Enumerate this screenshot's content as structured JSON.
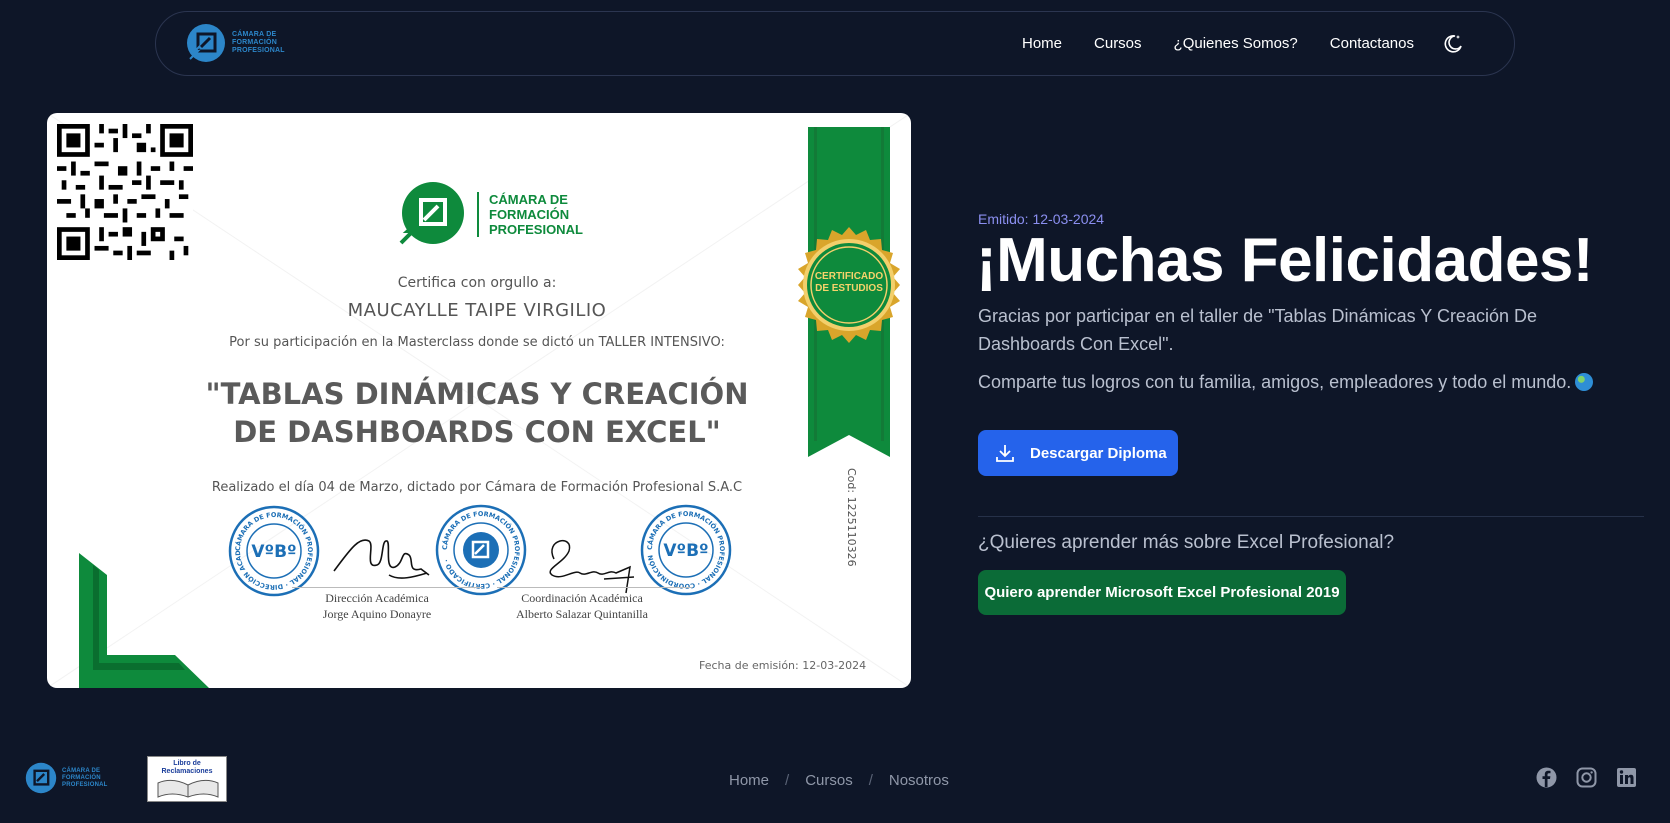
{
  "nav": {
    "logo_text": [
      "CÁMARA DE",
      "FORMACIÓN",
      "PROFESIONAL"
    ],
    "links": [
      "Home",
      "Cursos",
      "¿Quienes Somos?",
      "Contactanos"
    ],
    "theme_icon": "moon-stars-icon"
  },
  "certificate": {
    "logo_text": [
      "CÁMARA DE",
      "FORMACIÓN",
      "PROFESIONAL"
    ],
    "certifica": "Certifica con orgullo a:",
    "recipient": "MAUCAYLLE TAIPE VIRGILIO",
    "participation": "Por su participación en la Masterclass donde se dictó un TALLER INTENSIVO:",
    "course_title_line1": "\"TABLAS DINÁMICAS Y CREACIÓN",
    "course_title_line2": "DE DASHBOARDS CON EXCEL\"",
    "realizado": "Realizado el día 04 de Marzo, dictado por Cámara de Formación Profesional S.A.C",
    "seal_line1": "CERTIFICADO",
    "seal_line2": "DE ESTUDIOS",
    "code": "Cod: 1225110326",
    "stamp_vobo": "VºBº",
    "stamp_left_ring": "CÁMARA DE FORMACIÓN PROFESIONAL · DIRECCIÓN ACADÉMICA ·",
    "stamp_center_ring": "CÁMARA DE FORMACIÓN PROFESIONAL · CERTIFICADO ·",
    "stamp_right_ring": "CÁMARA DE FORMACIÓN PROFESIONAL · COORDINACIÓN ACADÉMICA ·",
    "signer1_role": "Dirección Académica",
    "signer1_name": "Jorge Aquino Donayre",
    "signer2_role": "Coordinación Académica",
    "signer2_name": "Alberto Salazar Quintanilla",
    "emision": "Fecha de emisión:   12-03-2024"
  },
  "panel": {
    "emitted": "Emitido: 12-03-2024",
    "headline": "¡Muchas Felicidades!",
    "thanks": "Gracias por participar en el taller de \"Tablas Dinámicas Y Creación De Dashboards Con Excel\".",
    "share": "Comparte tus logros con tu familia, amigos, empleadores y todo el mundo.",
    "download_label": "Descargar Diploma",
    "learn_question": "¿Quieres aprender más sobre Excel Profesional?",
    "learn_button": "Quiero aprender Microsoft Excel Profesional 2019"
  },
  "footer": {
    "logo_text": [
      "CÁMARA DE",
      "FORMACIÓN",
      "PROFESIONAL"
    ],
    "libro_line1": "Libro de",
    "libro_line2": "Reclamaciones",
    "links": [
      "Home",
      "Cursos",
      "Nosotros"
    ],
    "separator": "/",
    "socials": [
      "facebook-icon",
      "instagram-icon",
      "linkedin-icon"
    ]
  },
  "colors": {
    "background": "#0e1628",
    "primary_button": "#2563eb",
    "green_button": "#0b6b37",
    "accent_purple": "#8b8ff0",
    "brand_blue": "#2c86c9",
    "cert_green": "#0e8a3c"
  }
}
